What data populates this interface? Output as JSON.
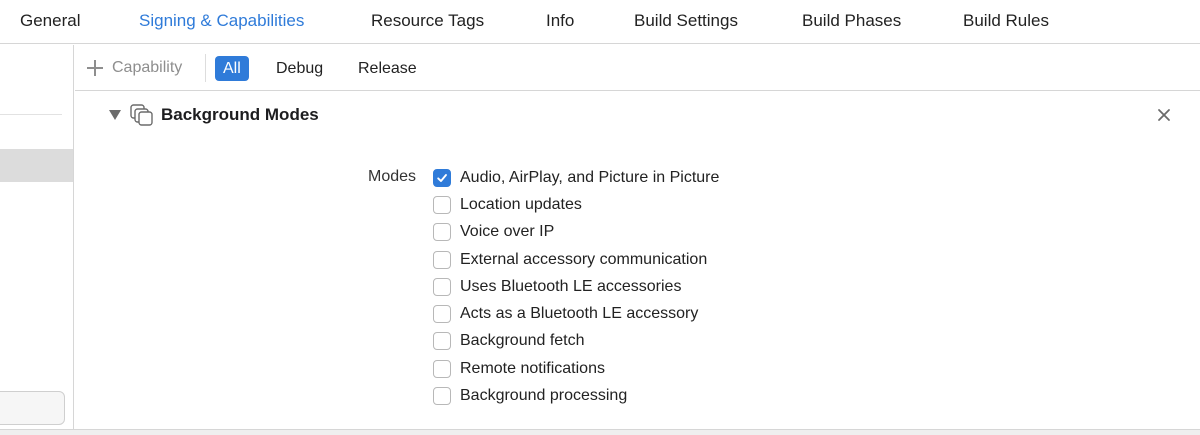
{
  "tabs": [
    {
      "label": "General",
      "active": false
    },
    {
      "label": "Signing & Capabilities",
      "active": true
    },
    {
      "label": "Resource Tags",
      "active": false
    },
    {
      "label": "Info",
      "active": false
    },
    {
      "label": "Build Settings",
      "active": false
    },
    {
      "label": "Build Phases",
      "active": false
    },
    {
      "label": "Build Rules",
      "active": false
    }
  ],
  "filterbar": {
    "add_capability_label": "Capability",
    "filters": [
      {
        "label": "All",
        "active": true
      },
      {
        "label": "Debug",
        "active": false
      },
      {
        "label": "Release",
        "active": false
      }
    ]
  },
  "capability": {
    "title": "Background Modes",
    "modes_label": "Modes",
    "modes": [
      {
        "label": "Audio, AirPlay, and Picture in Picture",
        "checked": true
      },
      {
        "label": "Location updates",
        "checked": false
      },
      {
        "label": "Voice over IP",
        "checked": false
      },
      {
        "label": "External accessory communication",
        "checked": false
      },
      {
        "label": "Uses Bluetooth LE accessories",
        "checked": false
      },
      {
        "label": "Acts as a Bluetooth LE accessory",
        "checked": false
      },
      {
        "label": "Background fetch",
        "checked": false
      },
      {
        "label": "Remote notifications",
        "checked": false
      },
      {
        "label": "Background processing",
        "checked": false
      }
    ]
  },
  "colors": {
    "accent": "#2f7bd9",
    "divider": "#d6d6d6",
    "selected_row": "#dcdcdc"
  }
}
